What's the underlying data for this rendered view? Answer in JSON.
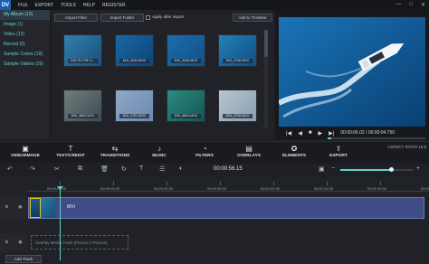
{
  "app": {
    "logo": "DV"
  },
  "menu": [
    "FILE",
    "EXPORT",
    "TOOLS",
    "HELP",
    "REGISTER"
  ],
  "window_controls": [
    "—",
    "□",
    "✕"
  ],
  "sidebar": {
    "items": [
      {
        "label": "My Album (13)"
      },
      {
        "label": "Image (1)"
      },
      {
        "label": "Video (12)"
      },
      {
        "label": "Record (0)"
      },
      {
        "label": "Sample Colors (19)"
      },
      {
        "label": "Sample Videos (19)"
      }
    ]
  },
  "media": {
    "import_files": "Import Files",
    "import_folder": "Import Folder",
    "apply_after_import": "Apply after import",
    "add_to_timeline": "Add to Timeline",
    "thumbs": [
      {
        "caption": "DAY IN THE LI...",
        "colors": [
          "#2f7fb0",
          "#1c4f78"
        ]
      },
      {
        "caption": "MVI_4044.MOV",
        "colors": [
          "#1a68a5",
          "#0e4475"
        ]
      },
      {
        "caption": "MVI_4045.MOV",
        "colors": [
          "#1b6dad",
          "#115184"
        ]
      },
      {
        "caption": "MVI_4746.MOV",
        "colors": [
          "#2380b8",
          "#0f4f80"
        ]
      },
      {
        "caption": "MVI_4802.MOV",
        "colors": [
          "#6f7d7c",
          "#3d4c54"
        ]
      },
      {
        "caption": "MVI_4751.MOV",
        "colors": [
          "#90a9c9",
          "#6c87ad"
        ]
      },
      {
        "caption": "MVI_4804.MOV",
        "colors": [
          "#2b8b83",
          "#13574f"
        ]
      },
      {
        "caption": "MVI_4749.MOV",
        "colors": [
          "#b7c5cf",
          "#8a9fb0"
        ]
      }
    ]
  },
  "preview": {
    "timecode": "00:00:06.02 / 00:00:04.750",
    "controls": [
      "|◀",
      "◀",
      "■",
      "▶",
      "▶|"
    ],
    "progress": 0.04
  },
  "tabs": [
    {
      "label": "VIDEO/IMAGE",
      "icon": "▣"
    },
    {
      "label": "TEXT/CREDIT",
      "icon": "T"
    },
    {
      "label": "TRANSITIONS",
      "icon": "⇆"
    },
    {
      "label": "MUSIC",
      "icon": "♪"
    },
    {
      "label": "FILTERS",
      "icon": "◔"
    },
    {
      "label": "OVERLAYS",
      "icon": "▤"
    },
    {
      "label": "ELEMENTS",
      "icon": "✪"
    },
    {
      "label": "EXPORT",
      "icon": "⇪"
    }
  ],
  "aspect_ratio": "ASPECT RATIO 16:9",
  "toolbar": {
    "icons": [
      "↶",
      "↷",
      "✂",
      "⧉",
      "🗑",
      "↻",
      "T",
      "☰",
      "◐"
    ],
    "time": "00:00:56.15",
    "right_icons": [
      "▣",
      "−",
      "+"
    ],
    "zoom": 0.7
  },
  "timeline": {
    "ticks": [
      "00:00:00.00",
      "00:00:15.00",
      "00:00:30.00",
      "00:00:45.00",
      "00:01:00.00",
      "00:01:15.00",
      "00:01:30.00",
      "00:01:45.00"
    ],
    "clip_name": "MVI",
    "overlay_placeholder": "Overlay Media Track (Picture in Picture)",
    "add_track": "Add Track"
  }
}
